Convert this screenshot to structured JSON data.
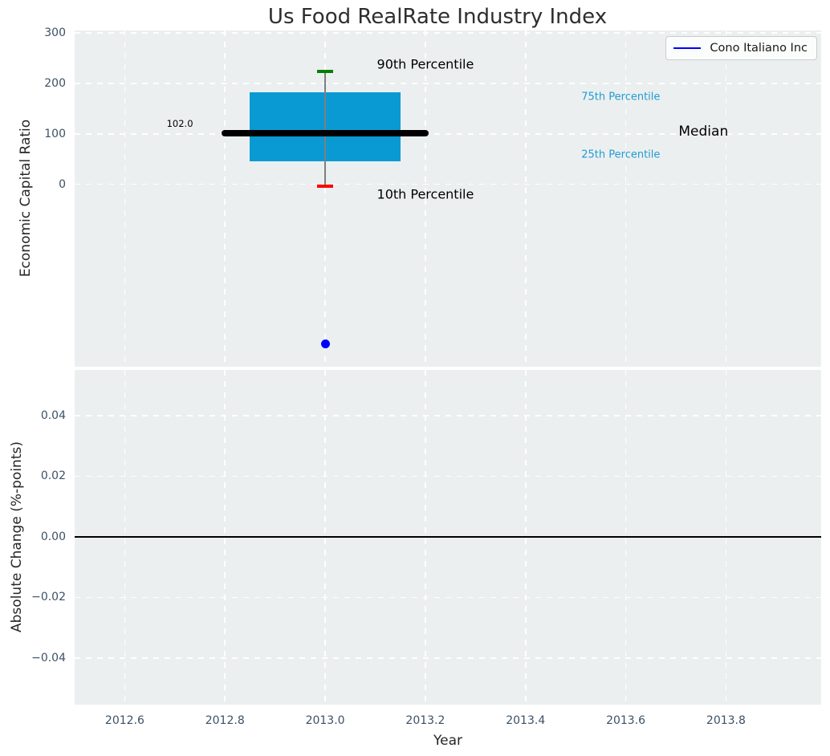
{
  "title": "Us Food RealRate Industry Index",
  "axes": {
    "top_ylabel": "Economic Capital Ratio",
    "bottom_ylabel": "Absolute Change (%-points)",
    "xlabel": "Year"
  },
  "legend": {
    "label": "Cono Italiano Inc",
    "line_color": "#0000ff",
    "position": "upper right"
  },
  "colors": {
    "figure_bg": "#ffffff",
    "plot_bg": "#eceff0",
    "grid": "#ffffff",
    "box_fill": "#099ad3",
    "median_line": "#000000",
    "whisker": "#7f7f7f",
    "p90_cap": "#008000",
    "p10_cap": "#ff0000",
    "company_point": "#0000ff",
    "tick_label": "#3d5166",
    "percentile_label": "#1e9cd2",
    "zero_line": "#000000"
  },
  "chart_data": [
    {
      "type": "boxplot",
      "panel": "top",
      "title": "Us Food RealRate Industry Index",
      "ylabel": "Economic Capital Ratio",
      "xlim": [
        2012.5,
        2013.99
      ],
      "ylim": [
        -362,
        305
      ],
      "xticks": [
        2012.6,
        2012.8,
        2013.0,
        2013.2,
        2013.4,
        2013.6,
        2013.8
      ],
      "yticks": [
        0,
        100,
        200,
        300
      ],
      "ytick_labels": [
        "0",
        "100",
        "200",
        "300"
      ],
      "grid": true,
      "box": {
        "x_center": 2013.0,
        "box_x_range": [
          2012.85,
          2013.15
        ],
        "median_x_range": [
          2012.8,
          2013.2
        ],
        "p10": -4,
        "p25": 46,
        "median": 102,
        "p75": 182,
        "p90": 224,
        "median_value_label": "102.0"
      },
      "series": [
        {
          "name": "Cono Italiano Inc",
          "type": "point",
          "x": 2013.0,
          "y": -316
        }
      ],
      "annotations": [
        {
          "name": "p90-annotation",
          "text": "90th Percentile",
          "x": 2013.2,
          "y": 238,
          "size": 16,
          "color": "#000000"
        },
        {
          "name": "p75-annotation",
          "text": "75th Percentile",
          "x": 2013.59,
          "y": 173,
          "size": 13,
          "color": "#1e9cd2"
        },
        {
          "name": "median-annotation",
          "text": "Median",
          "x": 2013.755,
          "y": 104,
          "size": 17,
          "color": "#000000"
        },
        {
          "name": "p25-annotation",
          "text": "25th Percentile",
          "x": 2013.59,
          "y": 58,
          "size": 13,
          "color": "#1e9cd2"
        },
        {
          "name": "p10-annotation",
          "text": "10th Percentile",
          "x": 2013.2,
          "y": -20,
          "size": 16,
          "color": "#000000"
        },
        {
          "name": "median-value-annotation",
          "text": "102.0",
          "x": 2012.71,
          "y": 121,
          "size": 11.5,
          "color": "#000000"
        }
      ]
    },
    {
      "type": "line",
      "panel": "bottom",
      "ylabel": "Absolute Change (%-points)",
      "xlabel": "Year",
      "xlim": [
        2012.5,
        2013.99
      ],
      "ylim": [
        -0.0554,
        0.0551
      ],
      "xticks": [
        2012.6,
        2012.8,
        2013.0,
        2013.2,
        2013.4,
        2013.6,
        2013.8
      ],
      "xtick_labels": [
        "2012.6",
        "2012.8",
        "2013.0",
        "2013.2",
        "2013.4",
        "2013.6",
        "2013.8"
      ],
      "yticks": [
        0.04,
        0.02,
        0.0,
        -0.02,
        -0.04
      ],
      "ytick_labels": [
        "0.04",
        "0.02",
        "0.00",
        "−0.02",
        "−0.04"
      ],
      "grid": true,
      "zero_line": 0.0,
      "series": []
    }
  ]
}
